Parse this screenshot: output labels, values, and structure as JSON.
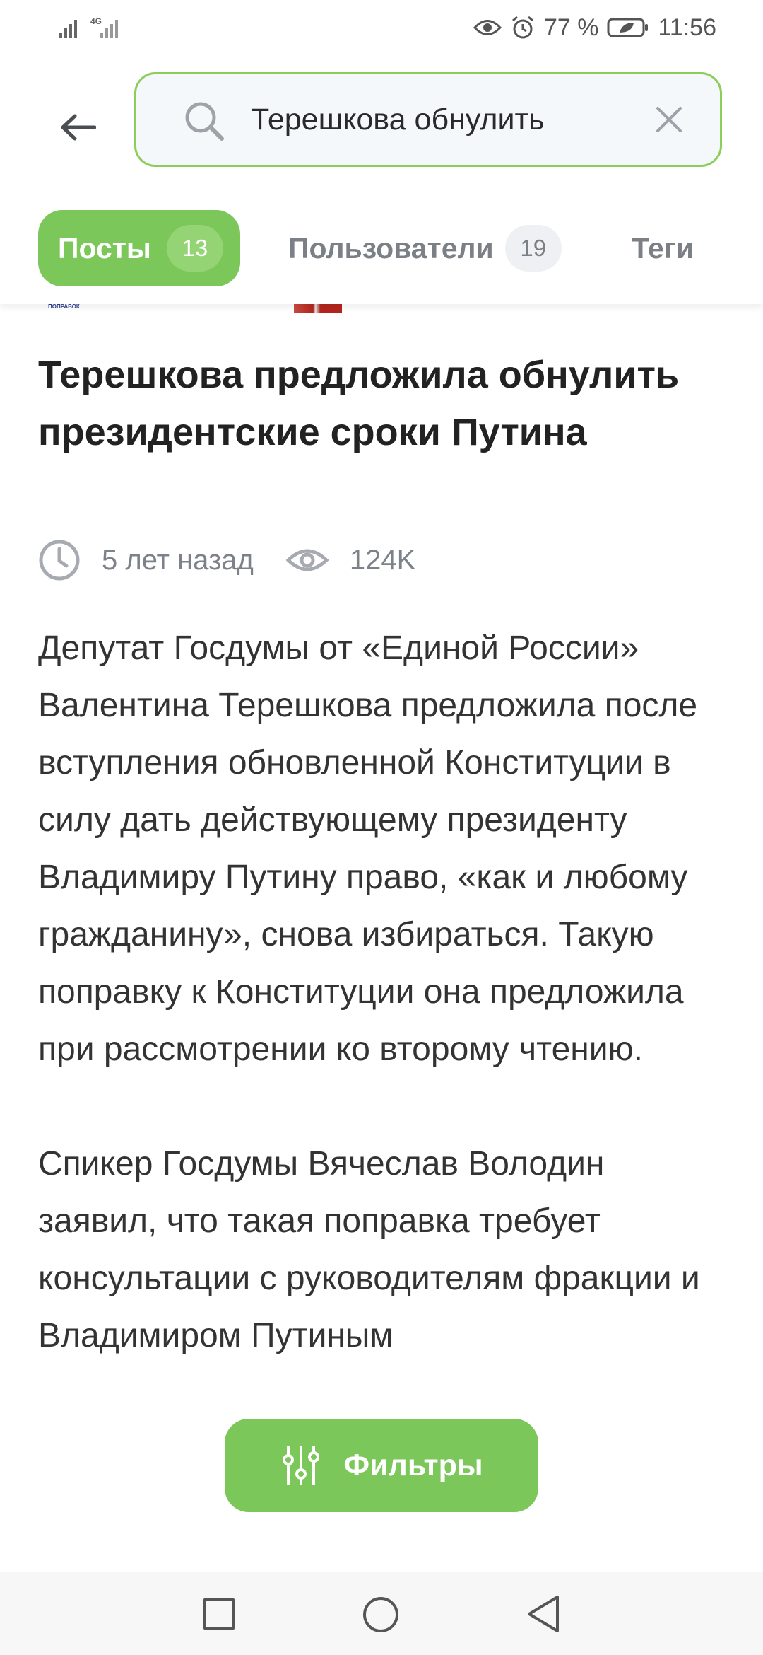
{
  "status_bar": {
    "network": "4G",
    "battery": "77 %",
    "time": "11:56",
    "icons": [
      "signal-icon",
      "eye-icon",
      "alarm-icon",
      "battery-icon"
    ]
  },
  "search": {
    "query": "Терешкова обнулить",
    "icons": [
      "back-arrow-icon",
      "search-icon",
      "clear-icon"
    ]
  },
  "tabs": [
    {
      "label": "Посты",
      "count": "13",
      "active": true
    },
    {
      "label": "Пользователи",
      "count": "19",
      "active": false
    },
    {
      "label": "Теги",
      "active": false
    }
  ],
  "thumbnail": {
    "logo_text": "ПОПРАВОК"
  },
  "article": {
    "title": "Терешкова предложила обнулить президентские сроки Путина",
    "time_ago": "5 лет назад",
    "views": "124K",
    "paragraphs": [
      "Депутат Госдумы от «Единой России» Валентина Терешкова предложила после вступления обновленной Конституции в силу дать действующему президенту Владимиру Путину право, «как и любому гражданину», снова избираться. Такую поправку к Конституции она предложила при рассмотрении ко второму чтению.",
      "Спикер Госдумы Вячеслав Володин заявил, что такая поправка требует консультации с руководителям фракции и Владимиром Путиным"
    ]
  },
  "filters_button": {
    "label": "Фильтры",
    "icon": "sliders-icon"
  },
  "nav_bar": {
    "icons": [
      "recent-apps-icon",
      "home-icon",
      "back-icon"
    ]
  },
  "colors": {
    "accent": "#7cc75a",
    "search_border": "#8ccc5a",
    "muted_text": "#7d8189"
  }
}
